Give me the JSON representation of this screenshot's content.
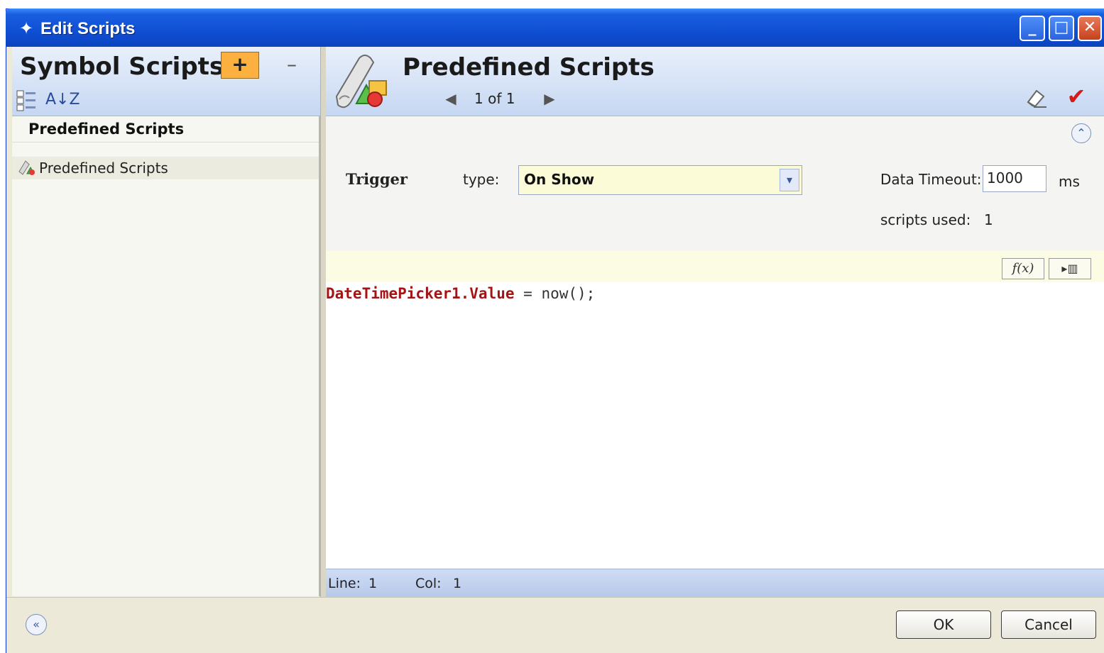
{
  "window": {
    "title": "Edit Scripts",
    "icon": "diamond-icon",
    "minimize_glyph": "_",
    "maximize_glyph": "□",
    "close_glyph": "✕"
  },
  "left_panel": {
    "title": "Symbol Scripts",
    "add_label": "+",
    "remove_label": "–",
    "sort_glyph": "A↓Z",
    "section_label": "Predefined Scripts",
    "tree_items": [
      {
        "label": "Predefined Scripts",
        "icon": "script-icon"
      }
    ]
  },
  "right_panel": {
    "title": "Predefined Scripts",
    "pager": {
      "prev": "◀",
      "text": "1 of 1",
      "next": "▶"
    },
    "check_glyph": "✔",
    "collapse_glyph": "⌃",
    "trigger": {
      "label": "Trigger",
      "type_label": "type:",
      "type_value": "On Show",
      "dropdown_glyph": "▾",
      "timeout_label": "Data Timeout:",
      "timeout_value": "1000",
      "timeout_unit": "ms",
      "scripts_used_label": "scripts used:",
      "scripts_used_value": "1"
    },
    "toolbar": {
      "fx_label": "f(x)",
      "insert_label": "▸▥"
    },
    "code": {
      "object": "DateTimePicker1.Value",
      "rest": " = now();"
    },
    "status": {
      "line_label": "Line:",
      "line_value": "1",
      "col_label": "Col:",
      "col_value": "1"
    }
  },
  "footer": {
    "expand_glyph": "«",
    "ok_label": "OK",
    "cancel_label": "Cancel"
  },
  "colors": {
    "titlebar": "#0f4fd3",
    "add_button": "#fbb040",
    "code_object": "#a31515",
    "confirm_check": "#d21b1b",
    "trigger_select_bg": "#fbfbd8"
  }
}
